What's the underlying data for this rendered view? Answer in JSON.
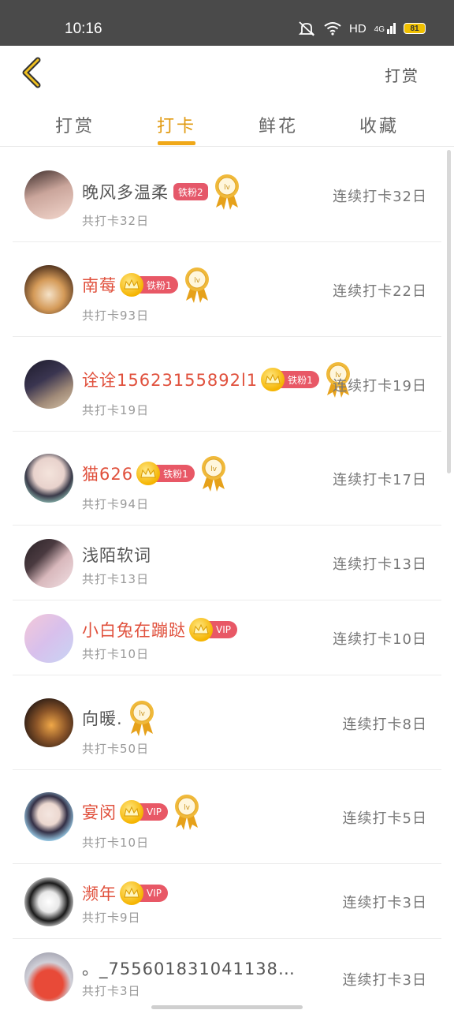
{
  "status": {
    "time": "10:16",
    "network": "HD",
    "signal": "4G",
    "battery": "81"
  },
  "header": {
    "action_label": "打赏"
  },
  "tabs": [
    {
      "label": "打赏",
      "active": false
    },
    {
      "label": "打卡",
      "active": true
    },
    {
      "label": "鲜花",
      "active": false
    },
    {
      "label": "收藏",
      "active": false
    }
  ],
  "rows": [
    {
      "name": "晚风多温柔",
      "name_color": "gray",
      "fan_badge": "铁粉2",
      "crown": false,
      "vip": false,
      "medal": true,
      "total": "共打卡32日",
      "streak": "连续打卡32日"
    },
    {
      "name": "南莓",
      "name_color": "red",
      "fan_badge": "铁粉1",
      "crown": true,
      "vip": false,
      "medal": true,
      "total": "共打卡93日",
      "streak": "连续打卡22日"
    },
    {
      "name": "诠诠15623155892l1",
      "name_color": "red",
      "fan_badge": "铁粉1",
      "crown": true,
      "vip": false,
      "medal": true,
      "total": "共打卡19日",
      "streak": "连续打卡19日"
    },
    {
      "name": "猫626",
      "name_color": "red",
      "fan_badge": "铁粉1",
      "crown": true,
      "vip": false,
      "medal": true,
      "total": "共打卡94日",
      "streak": "连续打卡17日"
    },
    {
      "name": "浅陌软词",
      "name_color": "gray",
      "fan_badge": "",
      "crown": false,
      "vip": false,
      "medal": false,
      "total": "共打卡13日",
      "streak": "连续打卡13日"
    },
    {
      "name": "小白兔在蹦跶",
      "name_color": "red",
      "fan_badge": "VIP",
      "crown": true,
      "vip": true,
      "medal": false,
      "total": "共打卡10日",
      "streak": "连续打卡10日"
    },
    {
      "name": "向暖.",
      "name_color": "gray",
      "fan_badge": "",
      "crown": false,
      "vip": false,
      "medal": true,
      "total": "共打卡50日",
      "streak": "连续打卡8日"
    },
    {
      "name": "宴闵",
      "name_color": "red",
      "fan_badge": "VIP",
      "crown": true,
      "vip": true,
      "medal": true,
      "total": "共打卡10日",
      "streak": "连续打卡5日"
    },
    {
      "name": "濒年",
      "name_color": "red",
      "fan_badge": "VIP",
      "crown": true,
      "vip": true,
      "medal": false,
      "total": "共打卡9日",
      "streak": "连续打卡3日"
    },
    {
      "name": "。_755601831041138…",
      "name_color": "gray",
      "fan_badge": "",
      "crown": false,
      "vip": false,
      "medal": false,
      "total": "共打卡3日",
      "streak": "连续打卡3日"
    }
  ],
  "colors": {
    "accent": "#f0a818",
    "name_red": "#e0503c",
    "badge_red": "#e5586a"
  }
}
